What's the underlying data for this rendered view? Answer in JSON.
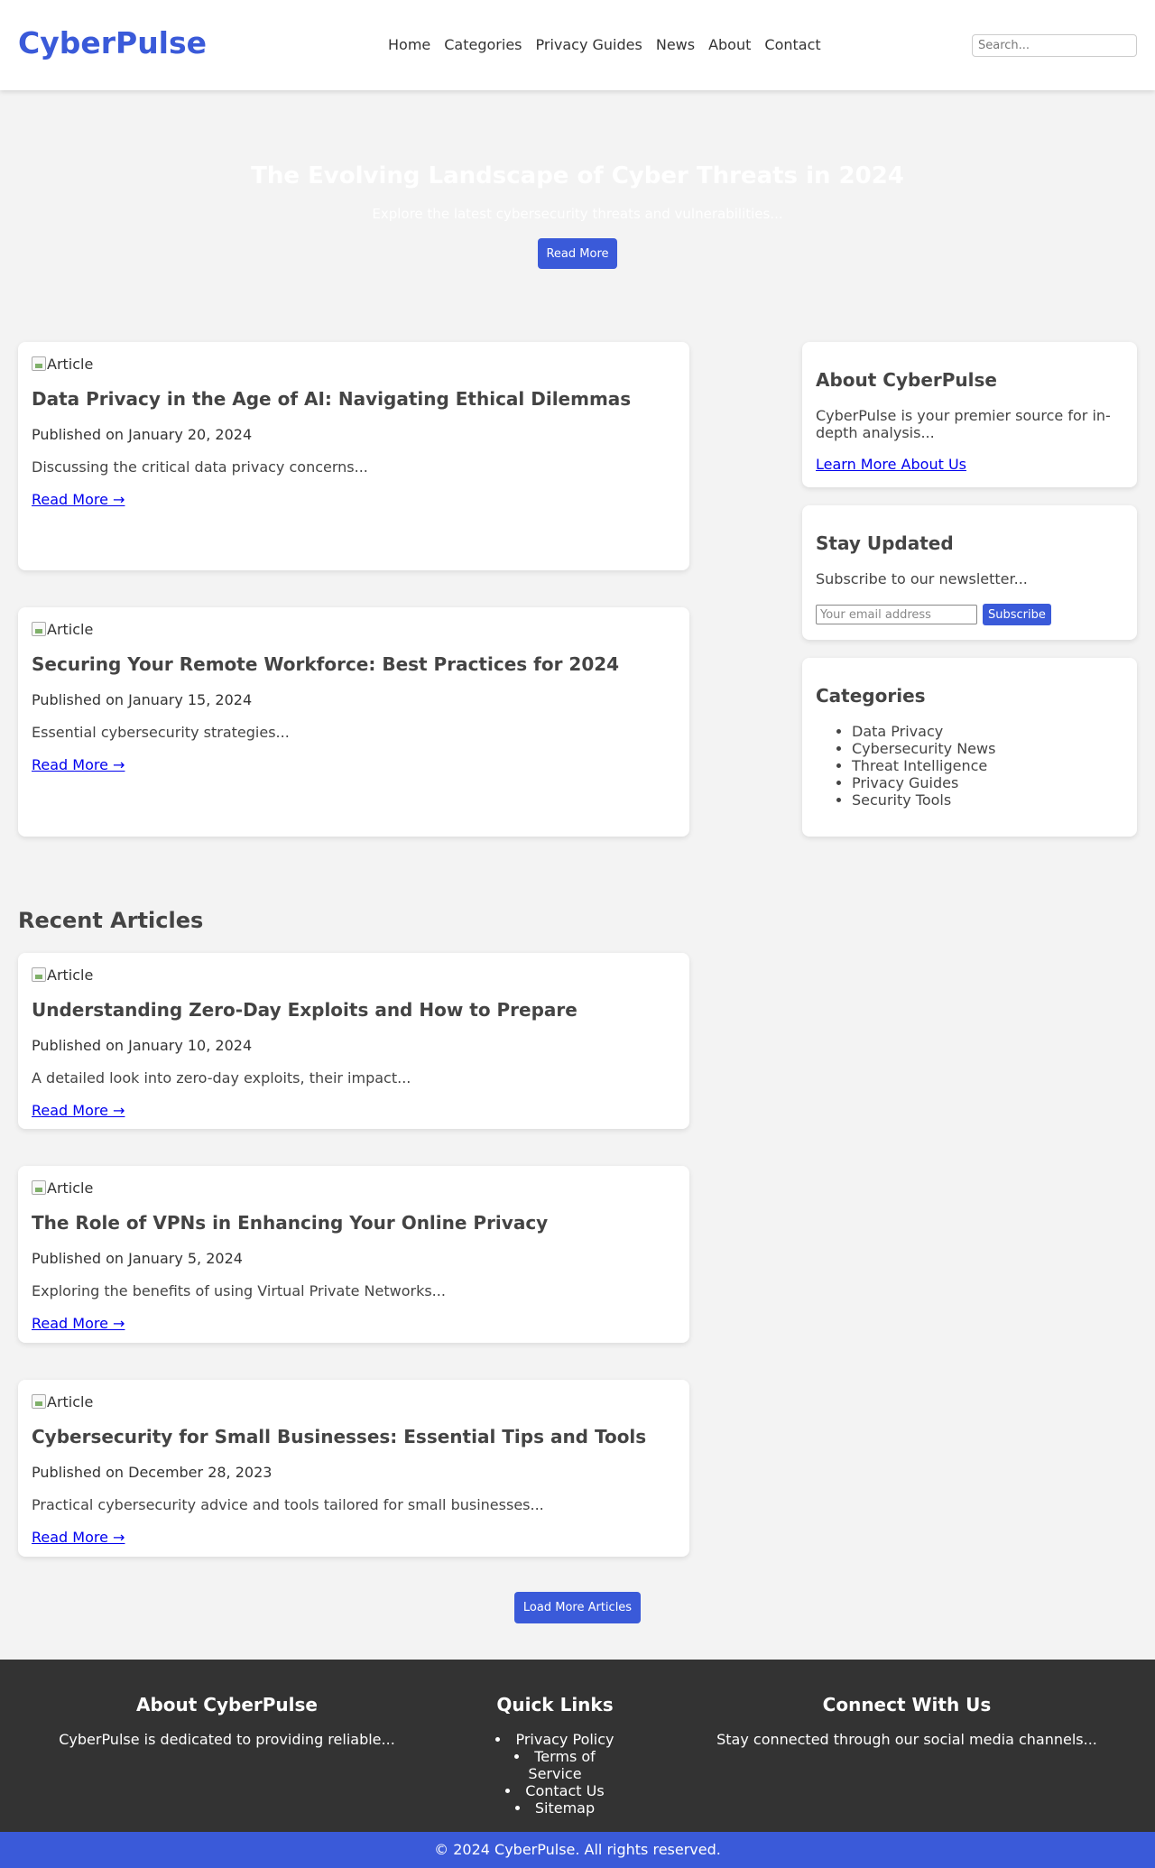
{
  "header": {
    "logo": "CyberPulse",
    "nav": [
      "Home",
      "Categories",
      "Privacy Guides",
      "News",
      "About",
      "Contact"
    ],
    "search_placeholder": "Search..."
  },
  "hero": {
    "title": "The Evolving Landscape of Cyber Threats in 2024",
    "subtitle": "Explore the latest cybersecurity threats and vulnerabilities...",
    "button": "Read More"
  },
  "featured": [
    {
      "image_alt": "Article",
      "title": "Data Privacy in the Age of AI: Navigating Ethical Dilemmas",
      "date": "Published on January 20, 2024",
      "excerpt": "Discussing the critical data privacy concerns...",
      "link": "Read More →"
    },
    {
      "image_alt": "Article",
      "title": "Securing Your Remote Workforce: Best Practices for 2024",
      "date": "Published on January 15, 2024",
      "excerpt": "Essential cybersecurity strategies...",
      "link": "Read More →"
    }
  ],
  "sidebar": {
    "about": {
      "title": "About CyberPulse",
      "text": "CyberPulse is your premier source for in-depth analysis...",
      "link": "Learn More About Us"
    },
    "newsletter": {
      "title": "Stay Updated",
      "text": "Subscribe to our newsletter...",
      "email_placeholder": "Your email address",
      "button": "Subscribe"
    },
    "categories": {
      "title": "Categories",
      "items": [
        "Data Privacy",
        "Cybersecurity News",
        "Threat Intelligence",
        "Privacy Guides",
        "Security Tools"
      ]
    }
  },
  "recent": {
    "title": "Recent Articles",
    "articles": [
      {
        "image_alt": "Article",
        "title": "Understanding Zero-Day Exploits and How to Prepare",
        "date": "Published on January 10, 2024",
        "excerpt": "A detailed look into zero-day exploits, their impact...",
        "link": "Read More →"
      },
      {
        "image_alt": "Article",
        "title": "The Role of VPNs in Enhancing Your Online Privacy",
        "date": "Published on January 5, 2024",
        "excerpt": "Exploring the benefits of using Virtual Private Networks...",
        "link": "Read More →"
      },
      {
        "image_alt": "Article",
        "title": "Cybersecurity for Small Businesses: Essential Tips and Tools",
        "date": "Published on December 28, 2023",
        "excerpt": "Practical cybersecurity advice and tools tailored for small businesses...",
        "link": "Read More →"
      }
    ],
    "load_more": "Load More Articles"
  },
  "footer": {
    "about": {
      "title": "About CyberPulse",
      "text": "CyberPulse is dedicated to providing reliable..."
    },
    "links": {
      "title": "Quick Links",
      "items": [
        "Privacy Policy",
        "Terms of Service",
        "Contact Us",
        "Sitemap"
      ]
    },
    "connect": {
      "title": "Connect With Us",
      "text": "Stay connected through our social media channels..."
    },
    "copyright": "© 2024 CyberPulse. All rights reserved."
  },
  "colors": {
    "brand": "#3a5ad9",
    "footer_bg": "#333333",
    "page_bg": "#f3f3f3"
  }
}
